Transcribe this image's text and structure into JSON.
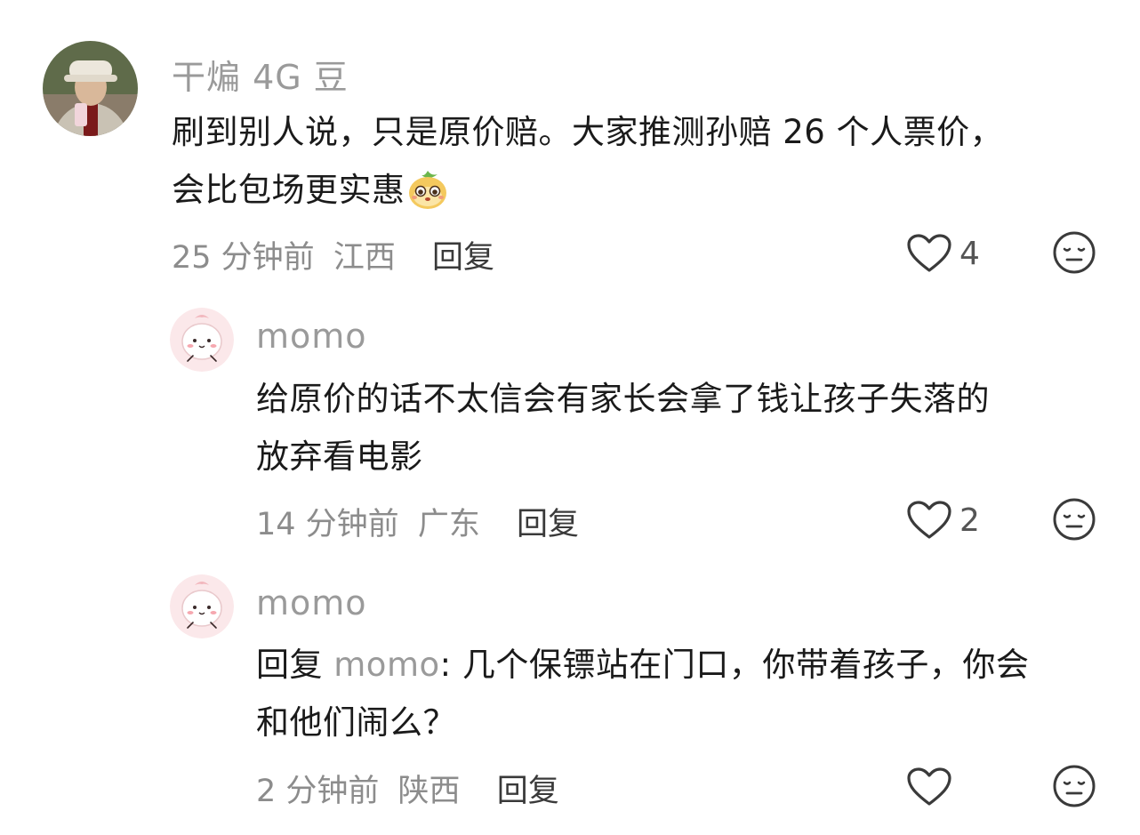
{
  "comments": [
    {
      "username": "干煸 4G 豆",
      "text_line1": "刷到别人说，只是原价赔。大家推测孙赔 26 个人票价，",
      "text_line2": "会比包场更实惠",
      "emoji": "smiling-mango-emoji",
      "time": "25 分钟前",
      "location": "江西",
      "reply_label": "回复",
      "likes": "4"
    },
    {
      "username": "momo",
      "text_line1": "给原价的话不太信会有家长会拿了钱让孩子失落的",
      "text_line2": "放弃看电影",
      "time": "14 分钟前",
      "location": "广东",
      "reply_label": "回复",
      "likes": "2"
    },
    {
      "username": "momo",
      "reply_prefix": "回复",
      "mention": "momo",
      "text_line1_rest": ": 几个保镖站在门口，你带着孩子，你会",
      "text_line2": "和他们闹么？",
      "time": "2 分钟前",
      "location": "陕西",
      "reply_label": "回复"
    }
  ],
  "icons": {
    "like": "heart-outline-icon",
    "dislike": "meh-face-icon"
  },
  "colors": {
    "text": "#1a1a1a",
    "muted": "#9a9a9a",
    "icon": "#3a3a3a"
  }
}
